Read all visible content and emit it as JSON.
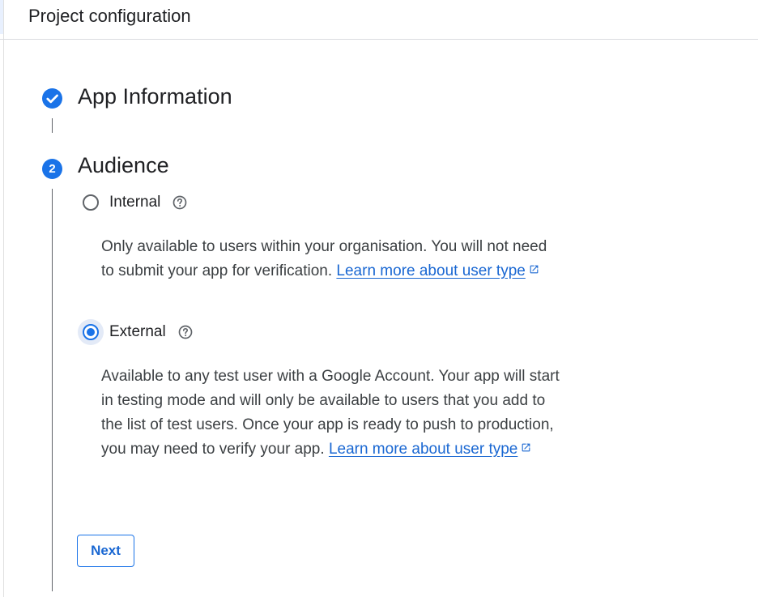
{
  "header": {
    "title": "Project configuration"
  },
  "steps": [
    {
      "number": "1",
      "title": "App Information",
      "status": "complete",
      "icon": "check-circle-icon"
    },
    {
      "number": "2",
      "title": "Audience",
      "status": "active"
    }
  ],
  "audience": {
    "internal": {
      "label": "Internal",
      "selected": false,
      "description": "Only available to users within your organisation. You will not need to submit your app for verification. ",
      "link_text": "Learn more about user type"
    },
    "external": {
      "label": "External",
      "selected": true,
      "description": "Available to any test user with a Google Account. Your app will start in testing mode and will only be available to users that you add to the list of test users. Once your app is ready to push to production, you may need to verify your app. ",
      "link_text": "Learn more about user type"
    }
  },
  "actions": {
    "next_label": "Next"
  },
  "colors": {
    "accent": "#1a73e8",
    "link": "#1967d2",
    "text": "#202124",
    "divider": "#dadce0"
  }
}
